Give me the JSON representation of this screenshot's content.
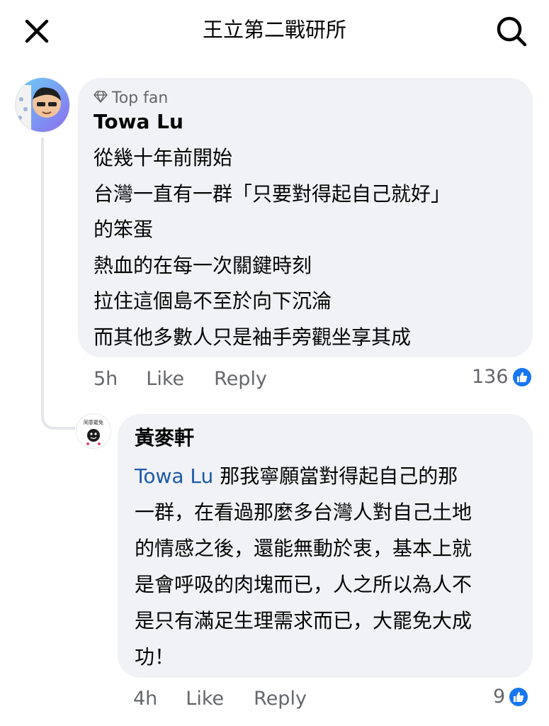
{
  "header": {
    "title": "王立第二戰研所",
    "close_icon": "close-icon",
    "search_icon": "search-icon"
  },
  "comments": [
    {
      "badge": "Top fan",
      "badge_icon": "diamond-icon",
      "author": "Towa Lu",
      "lines": [
        "從幾十年前開始",
        "台灣一直有一群「只要對得起自己就好」",
        "的笨蛋",
        "熱血的在每一次關鍵時刻",
        "拉住這個島不至於向下沉淪",
        "而其他多數人只是袖手旁觀坐享其成"
      ],
      "time": "5h",
      "like_label": "Like",
      "reply_label": "Reply",
      "reaction_count": "136",
      "reaction_icon": "like-reaction-icon"
    },
    {
      "author": "黃麥軒",
      "mention": "Towa Lu",
      "lines": [
        " 那我寧願當對得起自己的那",
        "一群，在看過那麼多台灣人對自己土地",
        "的情感之後，還能無動於衷，基本上就",
        "是會呼吸的肉塊而已，人之所以為人不",
        "是只有滿足生理需求而已，大罷免大成",
        "功！"
      ],
      "time": "4h",
      "like_label": "Like",
      "reply_label": "Reply",
      "reaction_count": "9",
      "reaction_icon": "like-reaction-icon"
    }
  ],
  "colors": {
    "bubble": "#f0f2f5",
    "mention": "#1e5aa8",
    "meta_text": "#65676b",
    "like_blue": "#1877f2"
  }
}
